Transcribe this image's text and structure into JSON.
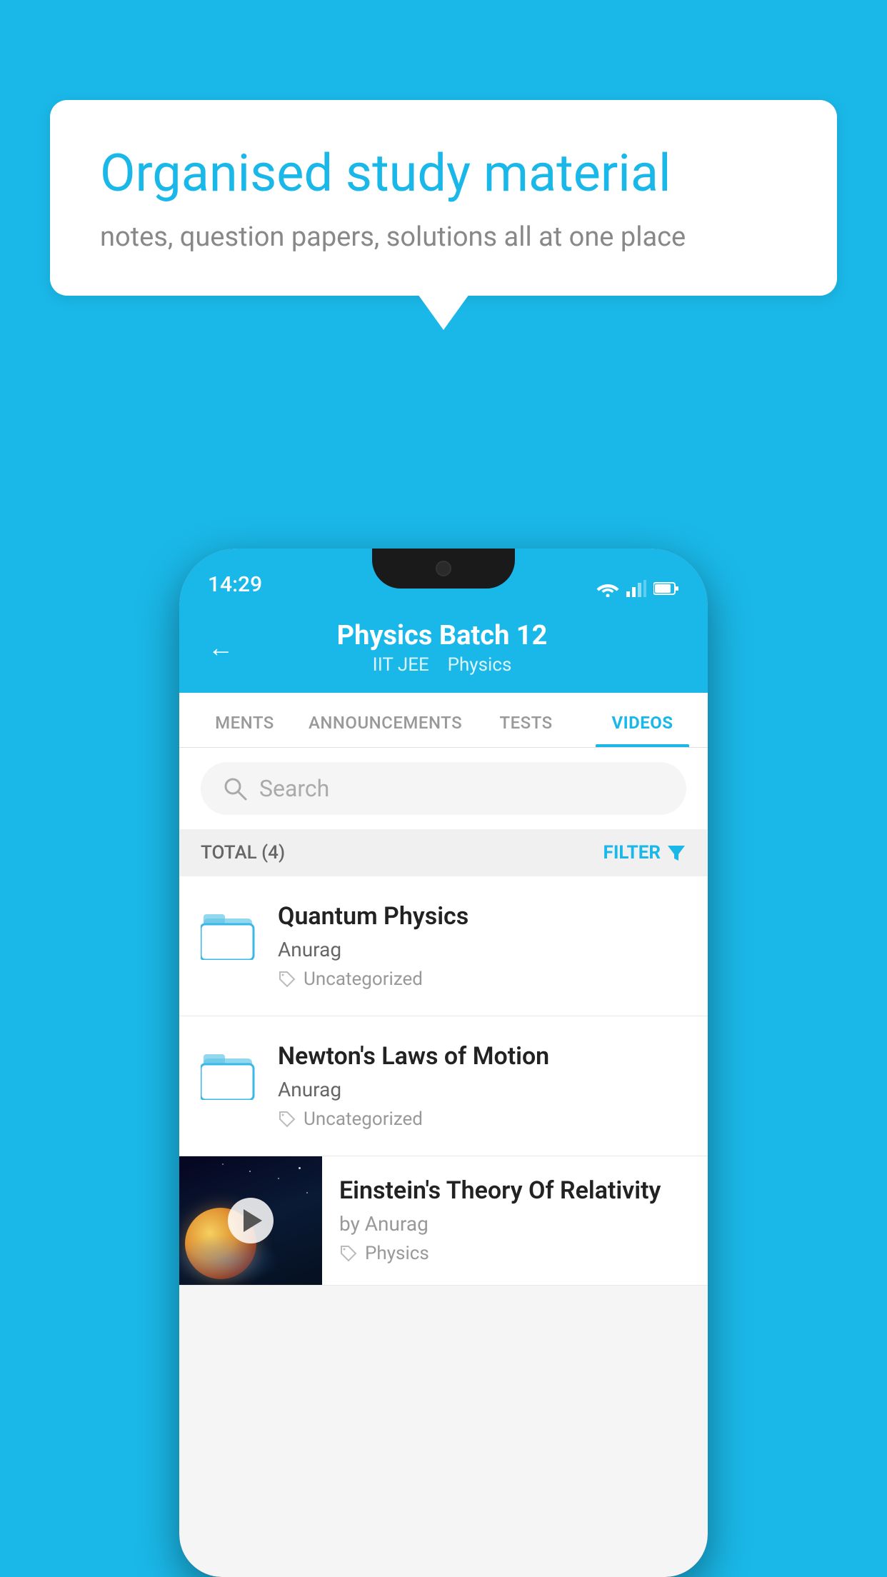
{
  "background_color": "#1ab8e8",
  "speech_bubble": {
    "title": "Organised study material",
    "subtitle": "notes, question papers, solutions all at one place"
  },
  "status_bar": {
    "time": "14:29",
    "wifi": "▾",
    "signal": "▴",
    "battery": "▪"
  },
  "header": {
    "back_label": "←",
    "title": "Physics Batch 12",
    "subtitle_tag1": "IIT JEE",
    "subtitle_tag2": "Physics"
  },
  "tabs": [
    {
      "label": "MENTS",
      "active": false
    },
    {
      "label": "ANNOUNCEMENTS",
      "active": false
    },
    {
      "label": "TESTS",
      "active": false
    },
    {
      "label": "VIDEOS",
      "active": true
    }
  ],
  "search": {
    "placeholder": "Search"
  },
  "filter": {
    "total_label": "TOTAL (4)",
    "filter_label": "FILTER"
  },
  "video_items": [
    {
      "title": "Quantum Physics",
      "author": "Anurag",
      "tag": "Uncategorized",
      "has_thumbnail": false
    },
    {
      "title": "Newton's Laws of Motion",
      "author": "Anurag",
      "tag": "Uncategorized",
      "has_thumbnail": false
    },
    {
      "title": "Einstein's Theory Of Relativity",
      "author": "by Anurag",
      "tag": "Physics",
      "has_thumbnail": true
    }
  ]
}
